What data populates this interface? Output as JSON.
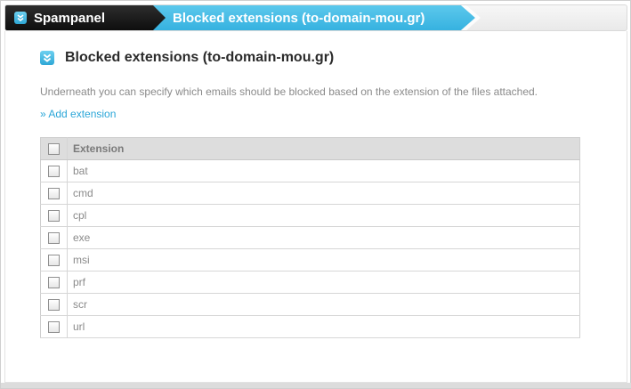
{
  "breadcrumb": {
    "root_label": "Spampanel",
    "current_label": "Blocked extensions (to-domain-mou.gr)"
  },
  "section": {
    "title": "Blocked extensions (to-domain-mou.gr)",
    "description": "Underneath you can specify which emails should be blocked based on the extension of the files attached.",
    "add_link": "» Add extension"
  },
  "table": {
    "header": "Extension",
    "rows": [
      "bat",
      "cmd",
      "cpl",
      "exe",
      "msi",
      "prf",
      "scr",
      "url"
    ]
  },
  "colors": {
    "accent": "#36b2e0",
    "dark": "#1a1a1a",
    "link": "#2aa6d8"
  },
  "icons": {
    "breadcrumb": "chevron-double-down-icon",
    "section": "chevron-double-down-icon"
  }
}
